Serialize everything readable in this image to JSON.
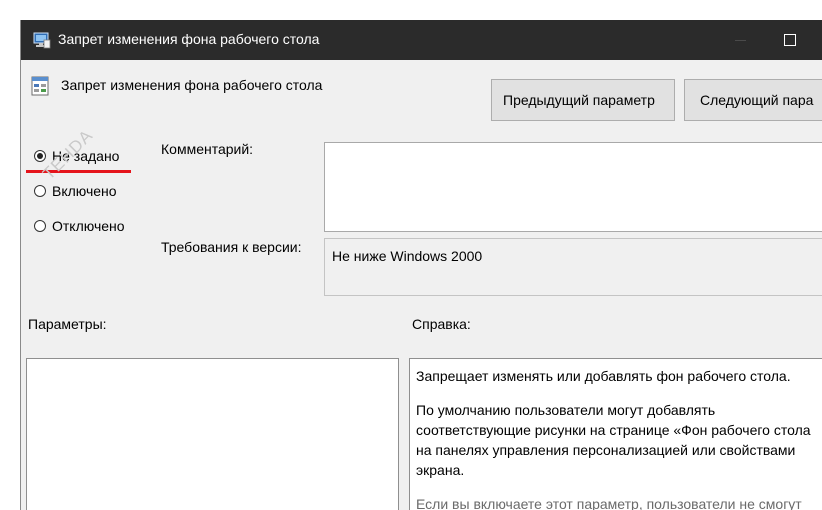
{
  "window": {
    "title": "Запрет изменения фона рабочего стола",
    "app_icon": "gpedit-icon",
    "controls": [
      "minimize-icon",
      "maximize-icon"
    ]
  },
  "policy": {
    "name": "Запрет изменения фона рабочего стола",
    "icon": "policy-setting-icon"
  },
  "navigation": {
    "prev_label": "Предыдущий параметр",
    "next_label": "Следующий пара"
  },
  "state": {
    "options": [
      {
        "label": "Не задано",
        "checked": true
      },
      {
        "label": "Включено",
        "checked": false
      },
      {
        "label": "Отключено",
        "checked": false
      }
    ],
    "highlight_color": "#e5141b"
  },
  "comment": {
    "label": "Комментарий:",
    "value": ""
  },
  "version": {
    "label": "Требования к версии:",
    "value": "Не ниже Windows 2000"
  },
  "options_panel": {
    "label": "Параметры:"
  },
  "help": {
    "label": "Справка:",
    "paragraphs": [
      "Запрещает изменять или добавлять фон рабочего стола.",
      "По умолчанию пользователи могут добавлять\nсоответствующие рисунки на странице «Фон рабочего стола\nна панелях управления персонализацией или свойствами\nэкрана.",
      "Если вы включаете этот параметр, пользователи не смогут"
    ]
  },
  "watermark": {
    "text": "TEHDA"
  },
  "colors": {
    "titlebar": "#2b2b2b",
    "dialog_bg": "#f0f0f0",
    "button_bg": "#e1e1e1"
  }
}
